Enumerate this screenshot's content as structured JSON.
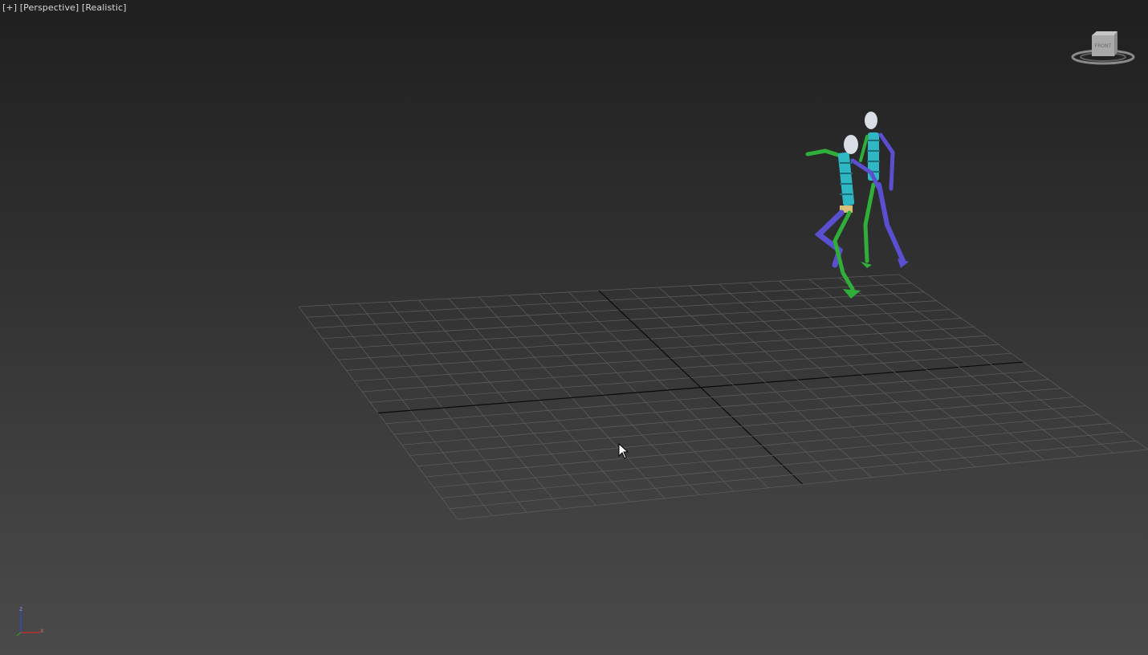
{
  "viewport": {
    "label_plus": "[+]",
    "label_view": "[Perspective]",
    "label_shading": "[Realistic]"
  },
  "viewcube": {
    "face_label": "FRONT",
    "icon": "viewcube-icon"
  },
  "axis_tripod": {
    "z_label": "z",
    "x_label": "x",
    "colors": {
      "z": "#2a4bd7",
      "x": "#d22a2a",
      "y": "#2aa02a"
    }
  },
  "scene": {
    "grid_color": "#5a5a5a",
    "axis_line_color": "#0a0a0a",
    "figure_colors": {
      "purple": "#5a4fcf",
      "green": "#2fae3a",
      "cyan": "#2fb7c4",
      "head": "#d8dde6",
      "pelvis": "#d9c07a"
    }
  },
  "colors": {
    "label_text": "#d8d8d8",
    "background_top": "#1f1f1f",
    "background_bottom": "#4a4a4a"
  }
}
